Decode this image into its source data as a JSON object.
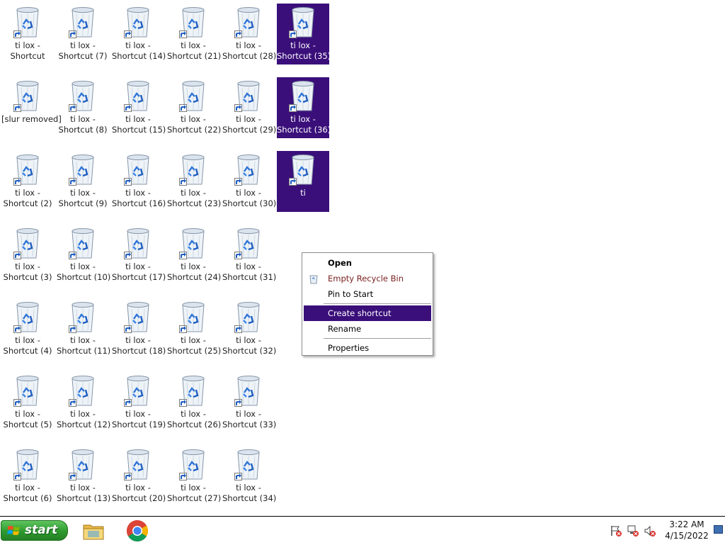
{
  "desktop": {
    "icons": [
      {
        "label": "ti lox -\nShortcut",
        "selected": false
      },
      {
        "label": "[slur removed]",
        "selected": false
      },
      {
        "label": "ti lox -\nShortcut (2)",
        "selected": false
      },
      {
        "label": "ti lox -\nShortcut (3)",
        "selected": false
      },
      {
        "label": "ti lox -\nShortcut (4)",
        "selected": false
      },
      {
        "label": "ti lox -\nShortcut (5)",
        "selected": false
      },
      {
        "label": "ti lox -\nShortcut (6)",
        "selected": false
      },
      {
        "label": "ti lox -\nShortcut (7)",
        "selected": false
      },
      {
        "label": "ti lox -\nShortcut (8)",
        "selected": false
      },
      {
        "label": "ti lox -\nShortcut (9)",
        "selected": false
      },
      {
        "label": "ti lox -\nShortcut (10)",
        "selected": false
      },
      {
        "label": "ti lox -\nShortcut (11)",
        "selected": false
      },
      {
        "label": "ti lox -\nShortcut (12)",
        "selected": false
      },
      {
        "label": "ti lox -\nShortcut (13)",
        "selected": false
      },
      {
        "label": "ti lox -\nShortcut (14)",
        "selected": false
      },
      {
        "label": "ti lox -\nShortcut (15)",
        "selected": false
      },
      {
        "label": "ti lox -\nShortcut (16)",
        "selected": false
      },
      {
        "label": "ti lox -\nShortcut (17)",
        "selected": false
      },
      {
        "label": "ti lox -\nShortcut (18)",
        "selected": false
      },
      {
        "label": "ti lox -\nShortcut (19)",
        "selected": false
      },
      {
        "label": "ti lox -\nShortcut (20)",
        "selected": false
      },
      {
        "label": "ti lox -\nShortcut (21)",
        "selected": false
      },
      {
        "label": "ti lox -\nShortcut (22)",
        "selected": false
      },
      {
        "label": "ti lox -\nShortcut (23)",
        "selected": false
      },
      {
        "label": "ti lox -\nShortcut (24)",
        "selected": false
      },
      {
        "label": "ti lox -\nShortcut (25)",
        "selected": false
      },
      {
        "label": "ti lox -\nShortcut (26)",
        "selected": false
      },
      {
        "label": "ti lox -\nShortcut (27)",
        "selected": false
      },
      {
        "label": "ti lox -\nShortcut (28)",
        "selected": false
      },
      {
        "label": "ti lox -\nShortcut (29)",
        "selected": false
      },
      {
        "label": "ti lox -\nShortcut (30)",
        "selected": false
      },
      {
        "label": "ti lox -\nShortcut (31)",
        "selected": false
      },
      {
        "label": "ti lox -\nShortcut (32)",
        "selected": false
      },
      {
        "label": "ti lox -\nShortcut (33)",
        "selected": false
      },
      {
        "label": "ti lox -\nShortcut (34)",
        "selected": false
      },
      {
        "label": "ti lox -\nShortcut (35)",
        "selected": true
      },
      {
        "label": "ti lox -\nShortcut (36)",
        "selected": true
      },
      {
        "label": "ti",
        "selected": true
      }
    ]
  },
  "context_menu": {
    "items": [
      {
        "label": "Open",
        "style": "bold"
      },
      {
        "label": "Empty Recycle Bin",
        "style": "red",
        "icon": "recycle-bin-icon"
      },
      {
        "label": "Pin to Start",
        "style": "normal"
      },
      {
        "label": "Create shortcut",
        "style": "highlighted"
      },
      {
        "label": "Rename",
        "style": "normal"
      },
      {
        "label": "Properties",
        "style": "normal"
      }
    ]
  },
  "taskbar": {
    "start_label": "start",
    "apps": [
      {
        "name": "File Explorer",
        "icon": "folder-icon"
      },
      {
        "name": "Google Chrome",
        "icon": "chrome-icon"
      }
    ],
    "tray_icons": [
      "action-center-flag-icon",
      "network-icon",
      "volume-icon"
    ],
    "clock": {
      "time": "3:22 AM",
      "date": "4/15/2022"
    }
  },
  "colors": {
    "selection": "#3a0f7a",
    "start_green": "#2e9a2e",
    "danger_text": "#7a1e1e"
  }
}
